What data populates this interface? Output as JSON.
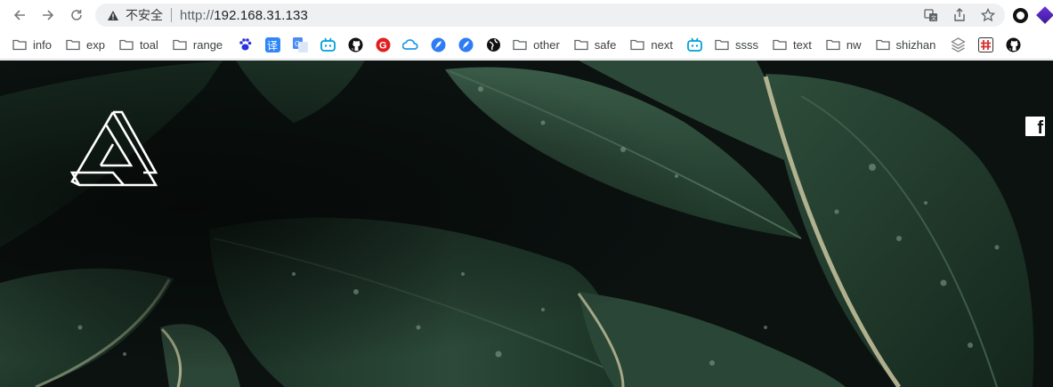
{
  "browser": {
    "security_label": "不安全",
    "url_scheme": "http://",
    "url_host": "192.168.31.133",
    "icons": {
      "back": "arrow-left-icon",
      "forward": "arrow-right-icon",
      "reload": "reload-icon",
      "warning": "warning-icon",
      "translate": "translate-icon",
      "share": "share-icon",
      "bookmark_star": "star-icon"
    }
  },
  "bookmarks": [
    {
      "type": "folder",
      "label": "info"
    },
    {
      "type": "folder",
      "label": "exp"
    },
    {
      "type": "folder",
      "label": "toal"
    },
    {
      "type": "folder",
      "label": "range"
    },
    {
      "type": "icon",
      "icon": "baidu-paw-icon",
      "color": "#2932e1"
    },
    {
      "type": "icon",
      "icon": "translate-yi-icon",
      "glyph": "译",
      "color": "#2f86f6"
    },
    {
      "type": "icon",
      "icon": "google-translate-icon",
      "color": "#4a8af4"
    },
    {
      "type": "icon",
      "icon": "bilibili-icon",
      "color": "#00a1d6"
    },
    {
      "type": "icon",
      "icon": "github-icon",
      "color": "#111111"
    },
    {
      "type": "icon",
      "icon": "red-g-icon",
      "color": "#e02020"
    },
    {
      "type": "icon",
      "icon": "cloud-icon",
      "color": "#1e9be8"
    },
    {
      "type": "icon",
      "icon": "feather-blue-icon",
      "color": "#2d7cf6"
    },
    {
      "type": "icon",
      "icon": "feather-blue-icon-2",
      "color": "#2d7cf6"
    },
    {
      "type": "icon",
      "icon": "globe-icon",
      "color": "#111111"
    },
    {
      "type": "folder",
      "label": "other"
    },
    {
      "type": "folder",
      "label": "safe"
    },
    {
      "type": "folder",
      "label": "next"
    },
    {
      "type": "icon",
      "icon": "bilibili-icon-2",
      "color": "#00a1d6"
    },
    {
      "type": "folder",
      "label": "ssss"
    },
    {
      "type": "folder",
      "label": "text"
    },
    {
      "type": "folder",
      "label": "nw"
    },
    {
      "type": "folder",
      "label": "shizhan"
    },
    {
      "type": "icon",
      "icon": "layers-icon",
      "color": "#888888"
    },
    {
      "type": "icon",
      "icon": "hash-red-icon",
      "color": "#d9302c"
    },
    {
      "type": "icon",
      "icon": "github-icon-2",
      "color": "#111111"
    }
  ],
  "hero": {
    "logo_icon": "penrose-triangle-logo",
    "social_icon": "facebook-icon",
    "social_glyph": "f",
    "background_color": "#0c1311",
    "leaf_color": "#1f3a2c"
  }
}
